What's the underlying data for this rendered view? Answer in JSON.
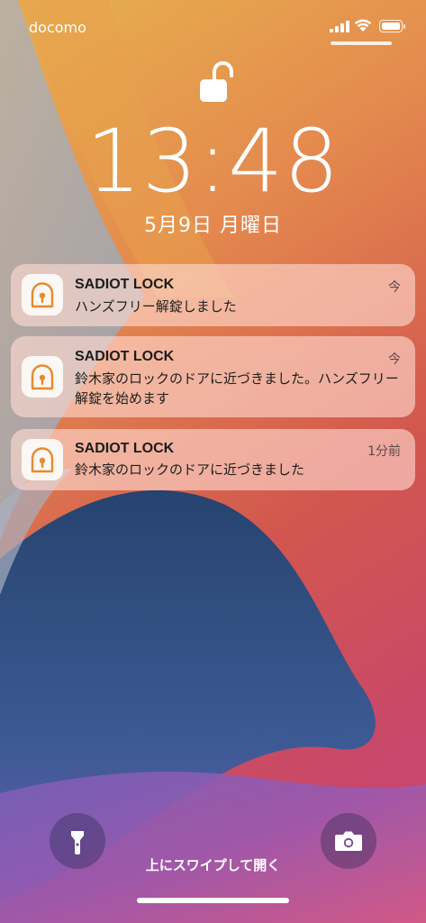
{
  "status_bar": {
    "carrier": "docomo",
    "signal_icon": "cellular-signal-icon",
    "wifi_icon": "wifi-icon",
    "battery_icon": "battery-icon"
  },
  "lock": {
    "icon": "unlocked-padlock-icon"
  },
  "clock": {
    "time": "13:48",
    "date": "5月9日 月曜日"
  },
  "notifications": [
    {
      "app": "SADIOT LOCK",
      "time": "今",
      "body": "ハンズフリー解錠しました"
    },
    {
      "app": "SADIOT LOCK",
      "time": "今",
      "body": "鈴木家のロックのドアに近づきました。ハンズフリー解錠を始めます"
    },
    {
      "app": "SADIOT LOCK",
      "time": "1分前",
      "body": "鈴木家のロックのドアに近づきました"
    }
  ],
  "bottom": {
    "flashlight_icon": "flashlight-icon",
    "camera_icon": "camera-icon",
    "swipe_hint": "上にスワイプして開く"
  },
  "colors": {
    "accent_icon": "#e58a2e",
    "wallpaper_top": "#e9a64a",
    "wallpaper_red": "#cf4a48",
    "wallpaper_blue": "#2e4f86",
    "wallpaper_purple": "#8a4ea6"
  }
}
